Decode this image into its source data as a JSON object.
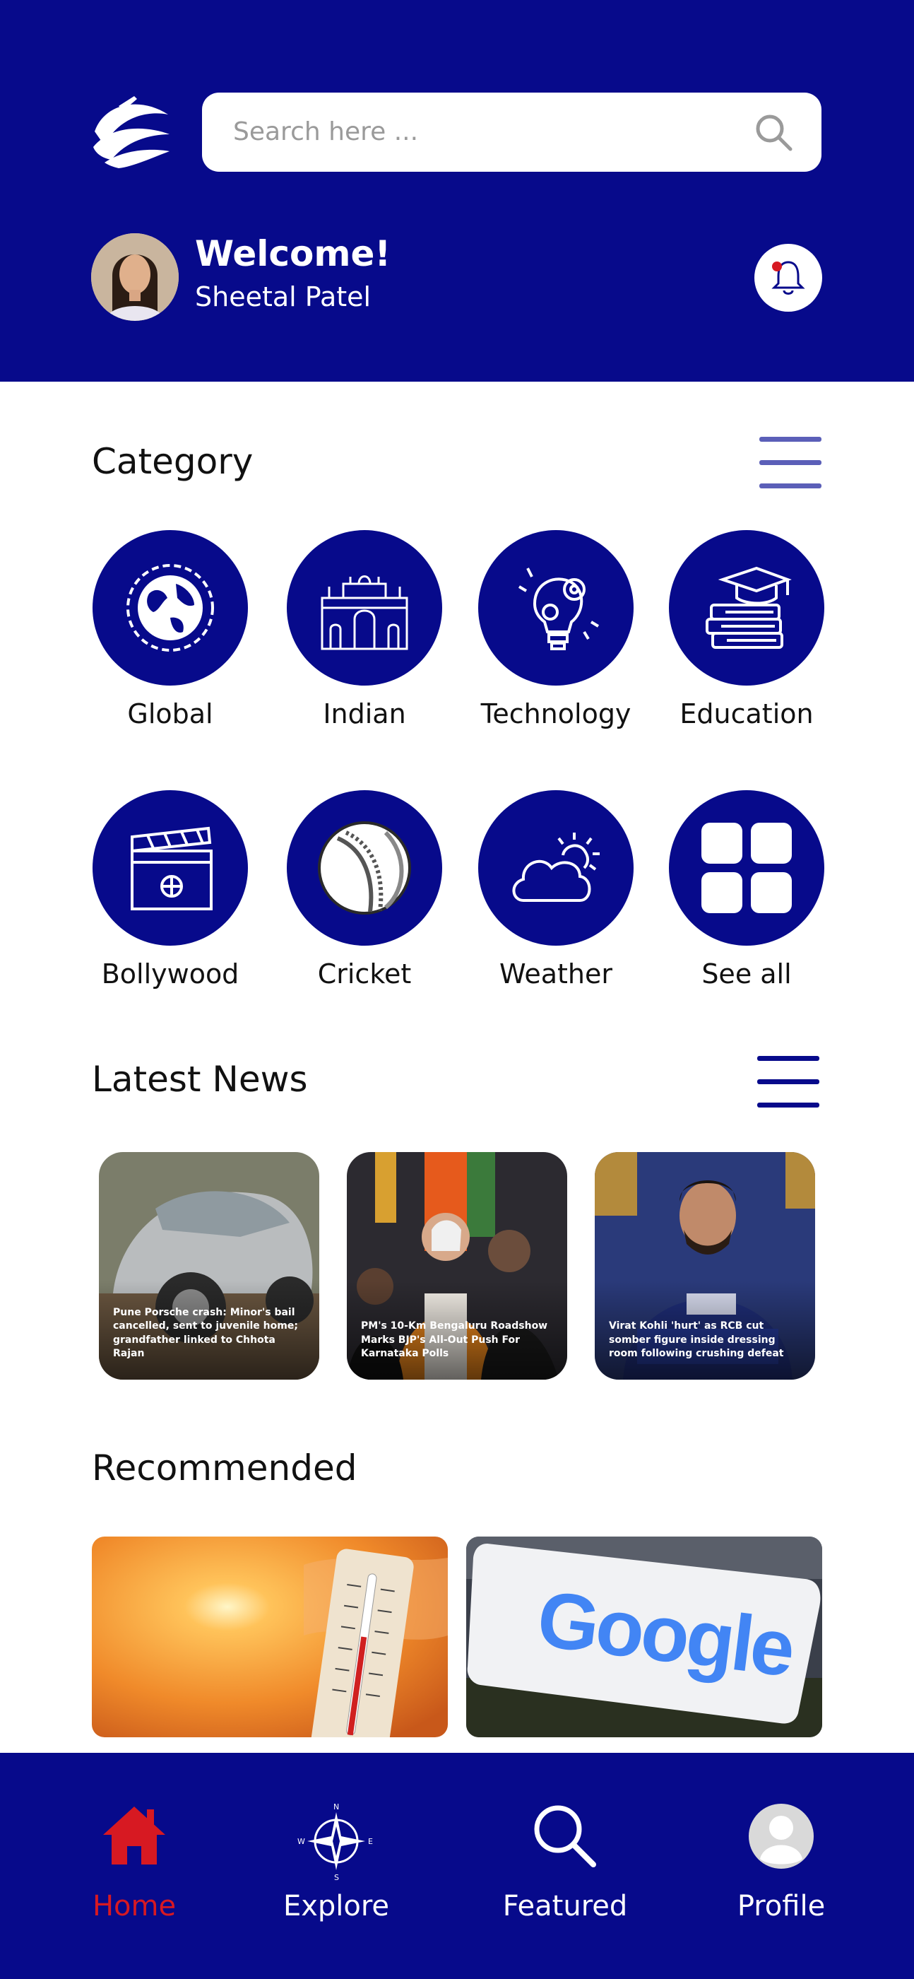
{
  "header": {
    "search_placeholder": "Search here ...",
    "welcome": "Welcome!",
    "user_name": "Sheetal Patel"
  },
  "category": {
    "title": "Category",
    "items": [
      {
        "label": "Global",
        "icon": "globe-icon"
      },
      {
        "label": "Indian",
        "icon": "gateway-of-india-icon"
      },
      {
        "label": "Technology",
        "icon": "gear-bulb-icon"
      },
      {
        "label": "Education",
        "icon": "books-cap-icon"
      },
      {
        "label": "Bollywood",
        "icon": "clapperboard-icon"
      },
      {
        "label": "Cricket",
        "icon": "cricket-ball-icon"
      },
      {
        "label": "Weather",
        "icon": "sun-cloud-icon"
      },
      {
        "label": "See all",
        "icon": "grid-icon"
      }
    ]
  },
  "latest_news": {
    "title": "Latest News",
    "items": [
      {
        "caption": "Pune Porsche crash: Minor's bail cancelled, sent to juvenile home; grandfather linked to Chhota Rajan"
      },
      {
        "caption": "PM's 10-Km Bengaluru Roadshow Marks BJP's All-Out Push For Karnataka Polls"
      },
      {
        "caption": "Virat Kohli 'hurt' as RCB cut somber figure inside dressing room following crushing defeat"
      }
    ]
  },
  "recommended": {
    "title": "Recommended",
    "items": [
      {
        "image": "thermometer-heat-image"
      },
      {
        "image": "google-sign-image",
        "logo_text": "Google"
      }
    ]
  },
  "bottom_nav": {
    "items": [
      {
        "label": "Home",
        "icon": "home-icon",
        "active": true
      },
      {
        "label": "Explore",
        "icon": "compass-icon",
        "active": false
      },
      {
        "label": "Featured",
        "icon": "search-icon",
        "active": false
      },
      {
        "label": "Profile",
        "icon": "profile-icon",
        "active": false
      }
    ]
  },
  "colors": {
    "primary": "#070a8b",
    "active_nav": "#d71922",
    "menu_icon_light": "#5b5fb8"
  }
}
